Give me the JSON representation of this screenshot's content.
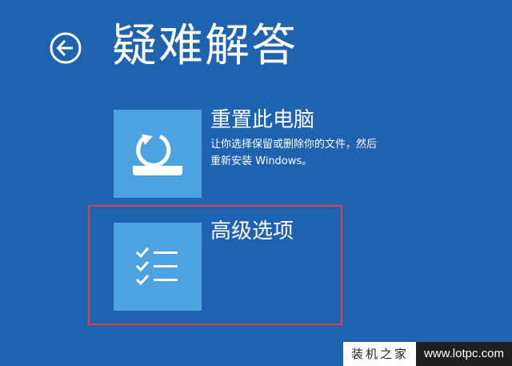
{
  "page": {
    "title": "疑难解答",
    "background_color": "#1e62b0"
  },
  "back_button": {
    "icon": "arrow-left-circle-icon"
  },
  "options": [
    {
      "title": "重置此电脑",
      "description_line1": "让你选择保留或删除你的文件，然后",
      "description_line2": "重新安装 Windows。",
      "icon": "reset-pc-icon",
      "tile_color": "#4da3e0"
    },
    {
      "title": "高级选项",
      "icon": "checklist-icon",
      "tile_color": "#4da3e0",
      "highlighted": true
    }
  ],
  "highlight_color": "#e0403e",
  "watermark": {
    "site_name": "装机之家",
    "url": "www.lotpc.com"
  }
}
